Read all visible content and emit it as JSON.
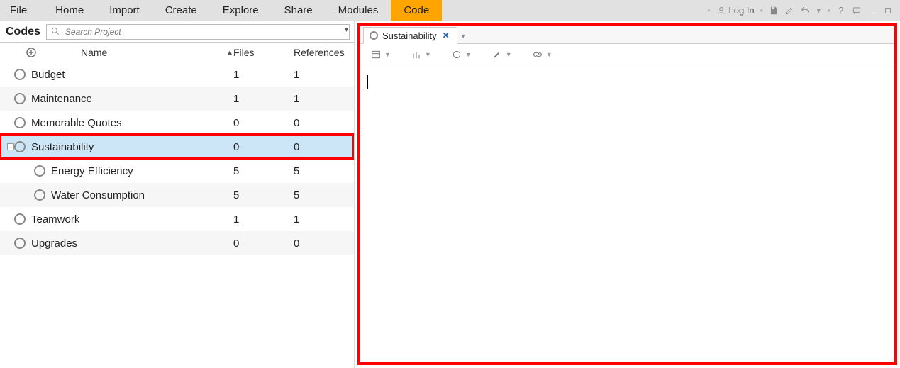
{
  "menu": {
    "items": [
      "File",
      "Home",
      "Import",
      "Create",
      "Explore",
      "Share",
      "Modules",
      "Code"
    ],
    "active": "Code",
    "login_label": "Log In"
  },
  "left": {
    "title": "Codes",
    "search_placeholder": "Search Project",
    "columns": {
      "name": "Name",
      "files": "Files",
      "refs": "References"
    },
    "rows": [
      {
        "name": "Budget",
        "files": "1",
        "refs": "1",
        "level": 0
      },
      {
        "name": "Maintenance",
        "files": "1",
        "refs": "1",
        "level": 0
      },
      {
        "name": "Memorable Quotes",
        "files": "0",
        "refs": "0",
        "level": 0
      },
      {
        "name": "Sustainability",
        "files": "0",
        "refs": "0",
        "level": 0,
        "selected": true,
        "expander": "-"
      },
      {
        "name": "Energy Efficiency",
        "files": "5",
        "refs": "5",
        "level": 1
      },
      {
        "name": "Water Consumption",
        "files": "5",
        "refs": "5",
        "level": 1
      },
      {
        "name": "Teamwork",
        "files": "1",
        "refs": "1",
        "level": 0
      },
      {
        "name": "Upgrades",
        "files": "0",
        "refs": "0",
        "level": 0
      }
    ]
  },
  "right": {
    "tab_label": "Sustainability"
  }
}
